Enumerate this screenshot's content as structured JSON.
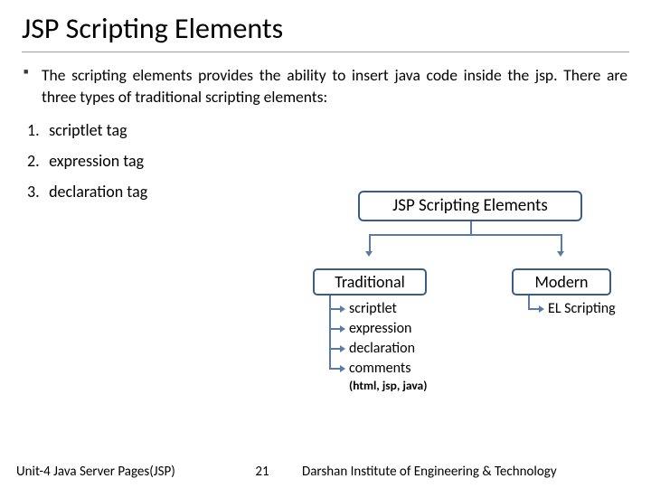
{
  "title": "JSP Scripting Elements",
  "body": "The scripting elements provides the ability to insert java code inside the jsp. There are three types of traditional scripting elements:",
  "list": {
    "item1": {
      "num": "1.",
      "label": "scriptlet tag"
    },
    "item2": {
      "num": "2.",
      "label": "expression tag"
    },
    "item3": {
      "num": "3.",
      "label": "declaration tag"
    }
  },
  "diagram": {
    "root": "JSP Scripting Elements",
    "traditional": {
      "label": "Traditional",
      "children": {
        "c1": "scriptlet",
        "c2": "expression",
        "c3": "declaration",
        "c4": "comments",
        "c4_note": "(html, jsp, java)"
      }
    },
    "modern": {
      "label": "Modern",
      "children": {
        "c1": "EL Scripting"
      }
    }
  },
  "footer": {
    "unit": "Unit-4 Java Server Pages(JSP)",
    "page": "21",
    "org": "Darshan Institute of Engineering & Technology"
  }
}
